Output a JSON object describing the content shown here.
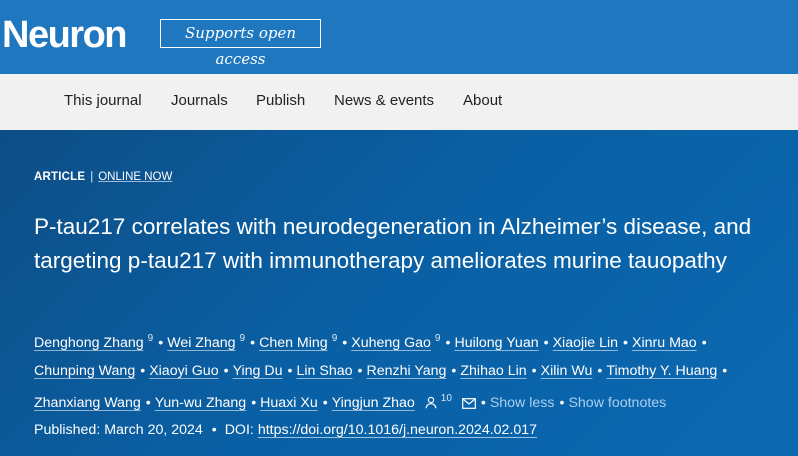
{
  "header": {
    "logo_text": "Neuron",
    "open_access_badge": "Supports open access"
  },
  "nav": {
    "items": [
      "This journal",
      "Journals",
      "Publish",
      "News & events",
      "About"
    ]
  },
  "article": {
    "type": "ARTICLE",
    "separator": "|",
    "status": "ONLINE NOW",
    "title": "P-tau217 correlates with neurodegeneration in Alzheimer’s disease, and targeting p-tau217 with immunotherapy ameliorates murine tauopathy",
    "authors": [
      {
        "name": "Denghong Zhang",
        "sup": "9"
      },
      {
        "name": "Wei Zhang",
        "sup": "9"
      },
      {
        "name": "Chen Ming",
        "sup": "9"
      },
      {
        "name": "Xuheng Gao",
        "sup": "9"
      },
      {
        "name": "Huilong Yuan"
      },
      {
        "name": "Xiaojie Lin"
      },
      {
        "name": "Xinru Mao"
      },
      {
        "name": "Chunping Wang"
      },
      {
        "name": "Xiaoyi Guo"
      },
      {
        "name": "Ying Du"
      },
      {
        "name": "Lin Shao"
      },
      {
        "name": "Renzhi Yang"
      },
      {
        "name": "Zhihao Lin"
      },
      {
        "name": "Xilin Wu"
      },
      {
        "name": "Timothy Y. Huang"
      },
      {
        "name": "Zhanxiang Wang"
      },
      {
        "name": "Yun-wu Zhang"
      },
      {
        "name": "Huaxi Xu"
      },
      {
        "name": "Yingjun Zhao",
        "sup": "10"
      }
    ],
    "show_less": "Show less",
    "show_footnotes": "Show footnotes",
    "published_label": "Published:",
    "published_date": "March 20, 2024",
    "doi_label": "DOI:",
    "doi": "https://doi.org/10.1016/j.neuron.2024.02.017",
    "icons": {
      "corresponding_author": "person-icon",
      "email": "envelope-icon"
    }
  }
}
